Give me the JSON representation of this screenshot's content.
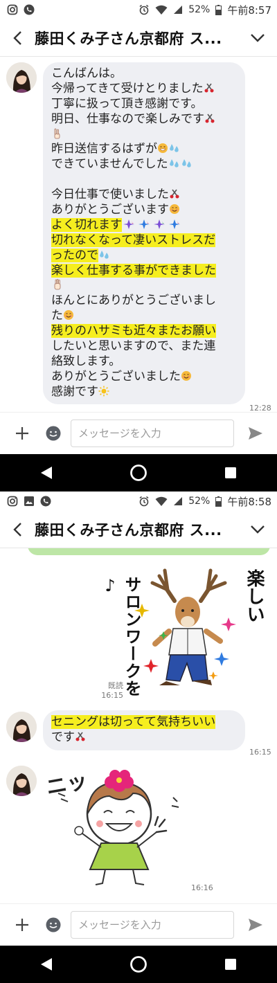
{
  "screens": [
    {
      "status": {
        "battery": "52%",
        "time": "午前8:57"
      },
      "title": "藤田くみ子さん京都府 ス...",
      "messages": [
        {
          "lines": [
            "こんばんは。",
            "今帰ってきて受けとりました",
            "丁寧に扱って頂き感謝です。",
            "明日、仕事なので楽しみです",
            "",
            "昨日送信するはずが",
            "できていませんでした",
            "",
            "今日仕事で使いました",
            "ありがとうございます",
            "よく切れます",
            "切れなくなって凄いストレスだ",
            "ったので",
            "楽しく仕事する事ができました",
            "",
            "ほんとにありがとうございまし",
            "た",
            "残りのハサミも近々またお願い",
            "したいと思いますので、また連",
            "絡致します。",
            "ありがとうございました",
            "感謝です"
          ],
          "time": "12:28"
        }
      ],
      "input_placeholder": "メッセージを入力"
    },
    {
      "status": {
        "battery": "52%",
        "time": "午前8:58"
      },
      "title": "藤田くみ子さん京都府 ス...",
      "sent_sticker": {
        "read": "既読",
        "time": "16:15",
        "text_left": "サロンワークを♪",
        "text_right": "楽しい"
      },
      "messages": [
        {
          "lines": [
            "セニングは切ってて気持ちいい",
            "です"
          ],
          "time": "16:15"
        }
      ],
      "received_sticker": {
        "time": "16:16",
        "text": "ニッ"
      },
      "input_placeholder": "メッセージを入力"
    }
  ],
  "colors": {
    "highlight": "#f6ee1f",
    "bubble": "#eeeff3",
    "sent_bubble": "#bde6a6",
    "navbar": "#000000"
  }
}
